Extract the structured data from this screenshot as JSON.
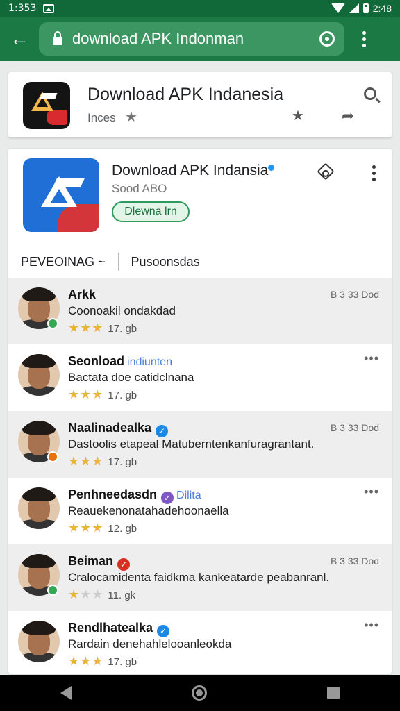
{
  "status_bar": {
    "time": "1:353",
    "right_time": "2:48"
  },
  "browser": {
    "url": "download APK Indonman"
  },
  "header_card": {
    "title": "Download APK Indanesia",
    "subtitle": "Inces"
  },
  "app": {
    "title": "Download APK Indansia",
    "subtitle": "Sood ABO",
    "install_label": "Dlewna lrn"
  },
  "tabs": [
    "PEVEOINAG ~",
    "Pusoonsdas"
  ],
  "reviews": [
    {
      "name": "Arkk",
      "comment": "Coonoakil ondakdad",
      "stars_filled": 3,
      "stars_half": 0,
      "rating": "17. gb",
      "meta": "B 3 33 Dod",
      "badge_color": "#34a853",
      "verified": false
    },
    {
      "name": "Seonload",
      "tag": "indiunten",
      "comment": "Bactata doe catidclnana",
      "stars_filled": 2,
      "stars_half": 1,
      "rating": "17. gb",
      "meta": "•••",
      "badge_color": "",
      "verified": false
    },
    {
      "name": "Naalinadealka",
      "comment": "Dastoolis etapeal Matuberntenkanfuragrantant.",
      "stars_filled": 3,
      "stars_half": 0,
      "rating": "17. gb",
      "meta": "B 3 33 Dod",
      "badge_color": "#e8710a",
      "verified": true,
      "verified_color": "#1e88e5"
    },
    {
      "name": "Penhneedasdn",
      "tag": "Dilita",
      "comment": "Reauekenonatahadehoonaella",
      "stars_filled": 3,
      "stars_half": 0,
      "rating": "12. gb",
      "meta": "•••",
      "badge_color": "",
      "verified": true,
      "verified_color": "#7e57c2"
    },
    {
      "name": "Beiman",
      "comment": "Cralocamidenta faidkma kankeatarde peabanranl.",
      "stars_filled": 1,
      "stars_half": 0,
      "rating": "11. gk",
      "meta": "B 3 33 Dod",
      "badge_color": "#34a853",
      "verified": true,
      "verified_color": "#d93025"
    },
    {
      "name": "Rendlhatealka",
      "comment": "Rardain denehahlelooanleokda",
      "stars_filled": 3,
      "stars_half": 0,
      "rating": "17. gb",
      "meta": "•••",
      "badge_color": "",
      "verified": true,
      "verified_color": "#1e88e5"
    }
  ],
  "colors": {
    "status_bar": "#11693a",
    "app_bar": "#1b7a43",
    "accent": "#2e9a5c",
    "star": "#e9b43a"
  }
}
